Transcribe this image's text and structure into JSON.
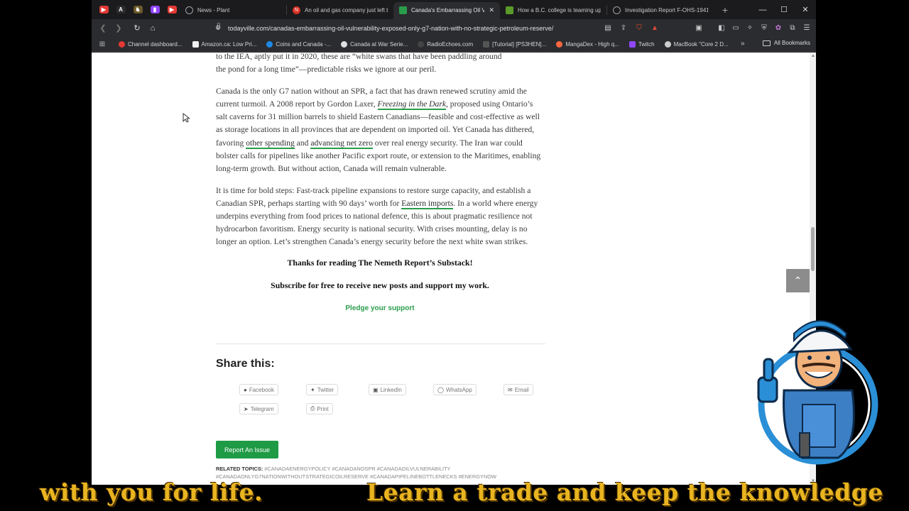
{
  "tabs": [
    {
      "title": "News - Plant",
      "icon_color": "#9aa0a6"
    },
    {
      "title": "An oil and gas company just left b",
      "icon_color": "#d93025"
    },
    {
      "title": "Canada's Embarrassing Oil Vu",
      "icon_color": "#2a9d4b",
      "active": true
    },
    {
      "title": "How a B.C. college is teaming up",
      "icon_color": "#5a9a2a"
    },
    {
      "title": "Investigation Report F-OHS-1941",
      "icon_color": "#9aa0a6"
    }
  ],
  "address_bar": {
    "url": "todayville.com/canadas-embarrassing-oil-vulnerability-exposed-only-g7-nation-with-no-strategic-petroleum-reserve/"
  },
  "bookmarks": [
    {
      "label": "Channel dashboard...",
      "color": "#e53935"
    },
    {
      "label": "Amazon.ca: Low Pri...",
      "color": "#f0f0f0"
    },
    {
      "label": "Coins and Canada -...",
      "color": "#1e88e5"
    },
    {
      "label": "Canada at War Serie...",
      "color": "#e0e0e0"
    },
    {
      "label": "RadioEchoes.com",
      "color": "#444444"
    },
    {
      "label": "[Tutorial] [PS3HEN]...",
      "color": "#555555"
    },
    {
      "label": "MangaDex - High q...",
      "color": "#ff6740"
    },
    {
      "label": "Twitch",
      "color": "#9146ff"
    },
    {
      "label": "MacBook \"Core 2 D...",
      "color": "#cccccc"
    }
  ],
  "all_bookmarks_label": "All Bookmarks",
  "article": {
    "para0_line1": "to the IEA, aptly put it in 2020, these are “white swans that have been paddling around",
    "para0_line2": "the pond for a long time”—predictable risks we ignore at our peril.",
    "para1_a": "Canada is the only G7 nation without an SPR, a fact that has drawn renewed scrutiny amid the current turmoil. A 2008 report by Gordon Laxer, ",
    "para1_link1": "Freezing in the Dark",
    "para1_b": ", proposed using Ontario’s salt caverns for 31 million barrels to shield Eastern Canadians—feasible and cost-effective as well as storage locations in all provinces that are dependent on imported oil. Yet Canada has dithered, favoring ",
    "para1_link2": "other spending",
    "para1_c": " and ",
    "para1_link3": "advancing net zero",
    "para1_d": " over real energy security. The Iran war could bolster calls for pipelines like another Pacific export route, or extension to the Maritimes, enabling long-term growth. But without action, Canada will remain vulnerable.",
    "para2_a": "It is time for bold steps: Fast-track pipeline expansions to restore surge capacity, and establish a Canadian SPR, perhaps starting with 90 days’ worth for ",
    "para2_link": "Eastern imports",
    "para2_b": ". In a world where energy underpins everything from food prices to national defence, this is about pragmatic resilience not hydrocarbon favoritism. Energy security is national security. With crises mounting, delay is no longer an option. Let’s strengthen Canada’s energy security before the next white swan strikes.",
    "thanks": "Thanks for reading The Nemeth Report’s Substack!",
    "subscribe": "Subscribe for free to receive new posts and support my work.",
    "pledge": "Pledge your support"
  },
  "share": {
    "title": "Share this:",
    "buttons": [
      "Facebook",
      "Twitter",
      "LinkedIn",
      "WhatsApp",
      "Email",
      "Telegram",
      "Print"
    ]
  },
  "report_button": "Report An Issue",
  "related": {
    "label": "RELATED TOPICS:",
    "topics_line1": "#CANADAENERGYPOLICY  #CANADANOSPR  #CANADAOILVULNERABILITY",
    "topics_line2": "#CANADAONLYG7NATIONWITHOUTSTRATEGICOILRESERVE  #CANADAPIPELINEBOTTLENECKS  #ENERGYNOW"
  },
  "caption": {
    "left": "with you for life.",
    "right": "Learn a trade and keep the knowledge"
  }
}
